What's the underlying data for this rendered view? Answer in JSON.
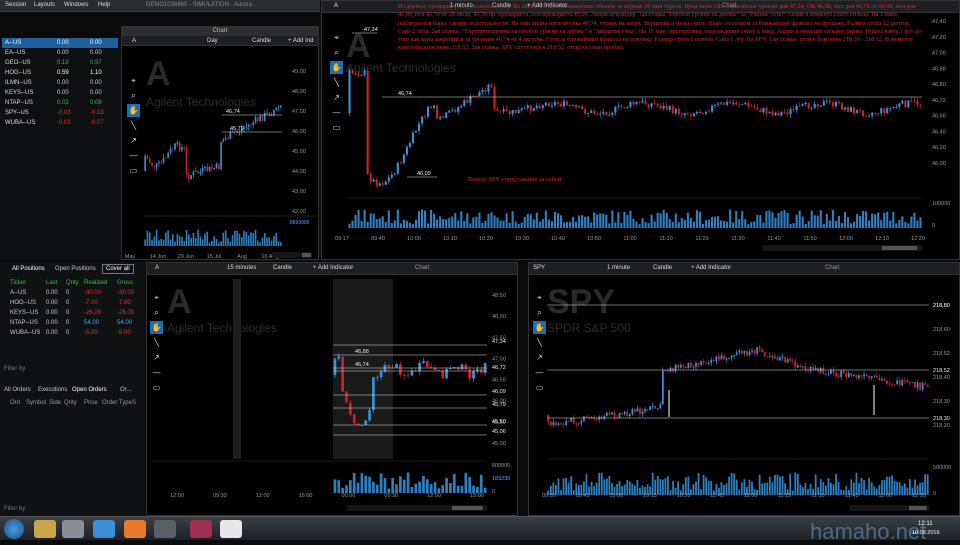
{
  "menu": {
    "items": [
      "Session",
      "Layouts",
      "Windows",
      "Help"
    ],
    "title": "DEMO1036860 - SIMULATION - Aurora"
  },
  "watchlist": {
    "rows": [
      {
        "sym": "A--US",
        "a": "0.00",
        "b": "0.00",
        "color": "#ffffff"
      },
      {
        "sym": "EA--US",
        "a": "0.00",
        "b": "0.00",
        "color": "#cccccc"
      },
      {
        "sym": "GEO--US",
        "a": "0.19",
        "b": "0.97",
        "color": "#3fbf3f"
      },
      {
        "sym": "HOG--US",
        "a": "0.59",
        "b": "1.10",
        "color": "#ffffff"
      },
      {
        "sym": "ILMN--US",
        "a": "0.00",
        "b": "0.00",
        "color": "#cccccc"
      },
      {
        "sym": "KEYS--US",
        "a": "0.00",
        "b": "0.00",
        "color": "#cccccc"
      },
      {
        "sym": "NTAP--US",
        "a": "0.02",
        "b": "0.08",
        "color": "#3fbf3f"
      },
      {
        "sym": "SPY--US",
        "a": "-0.03",
        "b": "-0.03",
        "color": "#e03030"
      },
      {
        "sym": "WUBA--US",
        "a": "-0.03",
        "b": "-0.07",
        "color": "#e03030"
      }
    ]
  },
  "chart1": {
    "title": "Chart",
    "symbol": "A",
    "interval": "Day",
    "type": "Candle",
    "add": "+ Add Ind",
    "watermark": "A",
    "company": "Agilent Technologies",
    "prices": [
      "49,00",
      "48,00",
      "47,00",
      "46,00",
      "45,00",
      "44,00",
      "43,00",
      "42,00"
    ],
    "xlabels": [
      "May",
      "14 Jun",
      "29 Jun",
      "15 Jul",
      "Aug",
      "16 Aug"
    ],
    "levels": [
      "46,74",
      "45,79"
    ],
    "vol": "8699995",
    "vol_label": "46,74"
  },
  "chart2": {
    "title": "Chart",
    "symbol": "A",
    "interval": "1 minute",
    "type": "Candle",
    "add": "+ Add Indicator",
    "watermark": "A",
    "company": "Agilent Technologies",
    "prices": [
      "47,40",
      "47,20",
      "47,00",
      "46,88",
      "46,80",
      "46,72",
      "46,60",
      "46,40",
      "46,20",
      "46,00"
    ],
    "xlabels": [
      "09:17",
      "09:40",
      "10:00",
      "10:10",
      "10:20",
      "10:30",
      "10:40",
      "10:50",
      "11:00",
      "11:10",
      "11:20",
      "11:30",
      "11:40",
      "11:50",
      "12:00",
      "12:10",
      "12:20"
    ],
    "levels": [
      "47,34",
      "46,74",
      "46,09"
    ],
    "vol": [
      "100000",
      "0"
    ],
    "note": "Из дневки: премаркет, гэп, вложенный бар. Из лента: 15 мин повышенные объемы за первые 30 мин торгов. Цена ниже ОК. Ближайшие уровни дня 47,34, ОК 46,88, пол дня 46,74 от 04.08, пол дня 46,09, пол 45,79 от 26 июля, 45,50 пр. премаркета, пол премаркета 45,06. Акция аутсайдер. 1ая ставка \"Пробой уровня на дневке\" за \"Ранние сеты\" Акция в моменте слабо сильна. На 15мин наблюдается бары, сжатие волатильности. На мин видна проторговка 46,74, отскок на вверх. Вершины и низы снизу. Шаре со стопом за ближайший фрактал на продажу. Размер стопа 12 центов. Сайз 2 лота. 2ая ставка: \"Перепроторговка на пробой уровня на дневке\" и \"закрытие гэпа\". На 15 мин: проторговка, подхождение снизу к пику. Акции в моменте сильнее рынка. Решил взять 1 лот до того как цена закрепится за уровнем 46,74 от 4 августа. Стоп за ближайший фрактал на покупку. Размер стопа 6 центов. Сайз 1 лот. На SPY: 1ая ставка: стоп в боковике 218,30 - 218,52. В моменте консолидация ниже 218,52. 2ая ставка: SPY спустился к 218,52, отскочил или пробил.",
    "result": "Вывод: SPY утянул акцию за собой."
  },
  "positions": {
    "tabs": [
      "All Positions",
      "Open Positions"
    ],
    "cover": "Cover all",
    "headers": [
      "Ticker",
      "Last",
      "Qnty",
      "Realized",
      "Gross"
    ],
    "rows": [
      {
        "t": "A--US",
        "l": "0.00",
        "q": "0",
        "r": "-30.00",
        "g": "-30.00"
      },
      {
        "t": "HOG--US",
        "l": "0.00",
        "q": "0",
        "r": "-7.00",
        "g": "-7.00"
      },
      {
        "t": "KEYS--US",
        "l": "0.00",
        "q": "0",
        "r": "-26.00",
        "g": "-26.00"
      },
      {
        "t": "NTAP--US",
        "l": "0.00",
        "q": "0",
        "r": "54.00",
        "g": "54.00"
      },
      {
        "t": "WUBA--US",
        "l": "0.00",
        "q": "0",
        "r": "-5.00",
        "g": "-5.00"
      }
    ],
    "filter": "Filter by"
  },
  "orders": {
    "tabs": [
      "All Orders",
      "Executions",
      "Open Orders",
      "Or..."
    ],
    "headers": [
      "Ord",
      "Symbol",
      "Side",
      "Qnty",
      "Price",
      "Order Type",
      "S"
    ],
    "filter": "Filter by"
  },
  "chart3": {
    "title": "Chart",
    "symbol": "A",
    "interval": "15 minutes",
    "type": "Candle",
    "add": "+ Add Indicator",
    "watermark": "A",
    "company": "Agilent Technologies",
    "prices": [
      "48,50",
      "48,00",
      "47,50",
      "47,00",
      "46,50",
      "46,00",
      "45,50",
      "45,00"
    ],
    "xlabels": [
      "12:00",
      "09:30",
      "12:00",
      "15:00",
      "00:00",
      "09:30",
      "12:00",
      "15:00"
    ],
    "levels": [
      "47,34",
      "46,88",
      "46,74",
      "46,72",
      "46,09",
      "45,79",
      "45,50",
      "45,06"
    ],
    "vol": [
      "500000",
      "183230",
      "0"
    ]
  },
  "chart4": {
    "title": "Chart",
    "symbol": "SPY",
    "interval": "1 minute",
    "type": "Candle",
    "add": "+ Add Indicator",
    "watermark": "SPY",
    "company": "SPDR S&P 500",
    "prices": [
      "218,80",
      "218,60",
      "218,52",
      "218,40",
      "218,30",
      "218,20"
    ],
    "xlabels": [
      "09:30",
      "09:45",
      "10:00",
      "10:15",
      "10:30",
      "10:45",
      "11:00",
      "11:15",
      "11:30",
      "11:45",
      "12:00",
      "12:15"
    ],
    "levels": [
      "218,80",
      "218,52",
      "218,30"
    ],
    "vol": [
      "500000",
      "0"
    ]
  },
  "taskbar": {
    "clock": "12:11",
    "date": "10.08.2016",
    "site": "hamaho.net"
  }
}
